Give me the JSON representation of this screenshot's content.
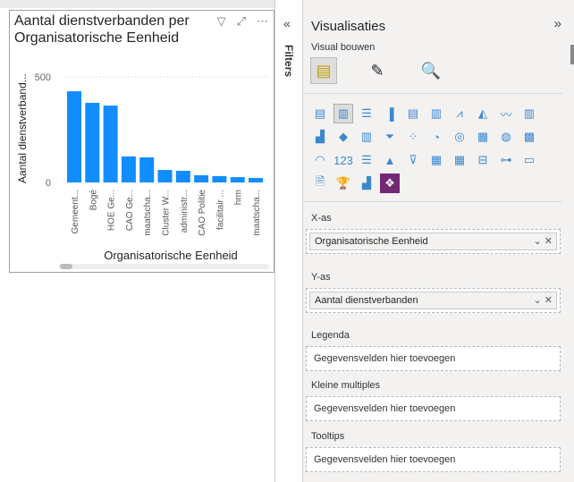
{
  "visual": {
    "title_line1": "Aantal dienstverbanden per",
    "title_line2": "Organisatorische Eenheid"
  },
  "chart_data": {
    "type": "bar",
    "title": "Aantal dienstverbanden per Organisatorische Eenheid",
    "xlabel": "Organisatorische Eenheid",
    "ylabel": "Aantal dienstverband...",
    "ylim": [
      0,
      500
    ],
    "yticks": [
      "0",
      "500"
    ],
    "categories": [
      "Gemeent...",
      "Bogé",
      "HOE Ge...",
      "CAO Ge...",
      "maatscha...",
      "Cluster W...",
      "administr...",
      "CAO Politie",
      "facilitair ...",
      "hrm",
      "maatscha..."
    ],
    "values": [
      432,
      377,
      364,
      123,
      119,
      59,
      55,
      34,
      30,
      25,
      21
    ],
    "color": "#118dff",
    "grid": "dotted"
  },
  "filters": {
    "label": "Filters",
    "collapse_icon": "«"
  },
  "pane": {
    "title": "Visualisaties",
    "expand_icon": "»",
    "subtitle": "Visual bouwen",
    "icons": [
      "▤",
      "▥",
      "☰",
      "▐",
      "▤",
      "▥",
      "⩘",
      "◭",
      "〰",
      "▥",
      "▟",
      "◆",
      "▥",
      "⏷",
      "⁘",
      "◔",
      "◎",
      "▦",
      "◍",
      "▩",
      "◠",
      "123",
      "☰",
      "▲",
      "⊽",
      "▦",
      "▦",
      "⊟",
      "⊶",
      "▭",
      "🗎",
      "🏆",
      "▟",
      "❖"
    ],
    "x_as": {
      "label": "X-as",
      "field": "Organisatorische Eenheid"
    },
    "y_as": {
      "label": "Y-as",
      "field": "Aantal dienstverbanden"
    },
    "legenda": {
      "label": "Legenda",
      "placeholder": "Gegevensvelden hier toevoegen"
    },
    "kleine": {
      "label": "Kleine multiples",
      "placeholder": "Gegevensvelden hier toevoegen"
    },
    "tooltips": {
      "label": "Tooltips",
      "placeholder": "Gegevensvelden hier toevoegen"
    }
  }
}
